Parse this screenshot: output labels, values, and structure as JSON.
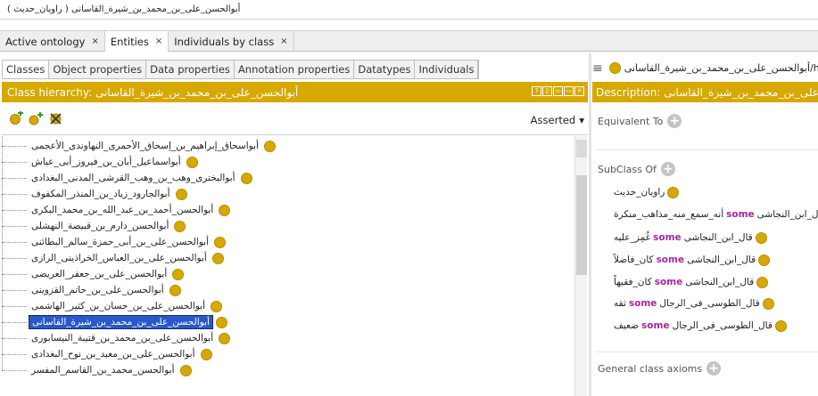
{
  "window": {
    "title": "أبوالحسن_على_بن_محمد_بن_شيرة_القاسانى ( راويان_حديث )"
  },
  "top_tabs": [
    {
      "label": "Active ontology",
      "close": "×"
    },
    {
      "label": "Entities",
      "close": "×"
    },
    {
      "label": "Individuals by class",
      "close": "×"
    }
  ],
  "left_tabs": [
    "Classes",
    "Object properties",
    "Data properties",
    "Annotation properties",
    "Datatypes",
    "Individuals"
  ],
  "class_panel": {
    "header": "Class hierarchy: أبوالحسن_على_بن_محمد_بن_شيرة_القاسانى",
    "header_buttons": [
      "?",
      "▯",
      "▭",
      "▭",
      "✕"
    ],
    "tools": [
      "add-subclass-icon",
      "add-sibling-icon",
      "delete-class-icon"
    ],
    "mode": "Asserted",
    "mode_arrow": "▾"
  },
  "tree_items": [
    {
      "label": "أبواسحاق_إبراهيم_بن_إسحاق_الأحمرى_النهاوندى_الأعجمى",
      "selected": false
    },
    {
      "label": "أبواسماعيل_أبان_بن_فيروز_أبى_عياش",
      "selected": false
    },
    {
      "label": "أبوالبخترى_وهب_بن_وهب_القرشى_المدنى_البغدادى",
      "selected": false
    },
    {
      "label": "أبوالجارود_زياد_بن_المنذر_المكفوف",
      "selected": false
    },
    {
      "label": "أبوالحسن_أحمد_بن_عبد_الله_بن_محمد_البكرى",
      "selected": false
    },
    {
      "label": "أبوالحسن_دارم_بن_قبيصة_النهشلى",
      "selected": false
    },
    {
      "label": "أبوالحسن_على_بن_أبى_حمزة_سالم_البطائنى",
      "selected": false
    },
    {
      "label": "أبوالحسن_على_بن_العباس_الخراذينى_الرازى",
      "selected": false
    },
    {
      "label": "أبوالحسن_على_بن_جعفر_العريضى",
      "selected": false
    },
    {
      "label": "أبوالحسن_على_بن_حاتم_القزوينى",
      "selected": false
    },
    {
      "label": "أبوالحسن_على_بن_حسان_بن_كثير_الهاشمى",
      "selected": false
    },
    {
      "label": "أبوالحسن_على_بن_محمد_بن_شيرة_القاسانى",
      "selected": true
    },
    {
      "label": "أبوالحسن_على_بن_محمد_بن_قتيبة_النيسابورى",
      "selected": false
    },
    {
      "label": "أبوالحسن_على_بن_معبد_بن_نوح_البغدادى",
      "selected": false
    },
    {
      "label": "أبوالحسن_محمد_بن_القاسم_المفسر",
      "selected": false
    }
  ],
  "right_panel": {
    "menu_icon": "≡",
    "url_text": "http://www.s/أبوالحسن_على_بن_محمد_بن_شيرة_القاسانى",
    "desc_header": "Description: أبوالحسن_على_بن_محمد_بن_شيرة_القاسانى",
    "equivalent_label": "Equivalent To",
    "subclass_label": "SubClass Of",
    "general_label": "General class axioms",
    "keyword": "some",
    "subclass_items": [
      {
        "pre": "",
        "post": "راويان_حديث"
      },
      {
        "pre": "أنه_سمع_منه_مذاهب_منكرة",
        "post": "قال_ابن_النجاشى"
      },
      {
        "pre": "غُمِز_عليه",
        "post": "قال_ابن_النجاشى"
      },
      {
        "pre": "كان_فاضلاً",
        "post": "قال_ابن_النجاشى"
      },
      {
        "pre": "كان_فقيهاً",
        "post": "قال_ابن_النجاشى"
      },
      {
        "pre": "ثقه",
        "post": "قال_الطوسى_فى_الرجال"
      },
      {
        "pre": "ضعيف",
        "post": "قال_الطوسى_فى_الرجال"
      }
    ]
  },
  "colors": {
    "accent": "#d6a800",
    "selection": "#2a58c9",
    "keyword": "#a6299e"
  }
}
